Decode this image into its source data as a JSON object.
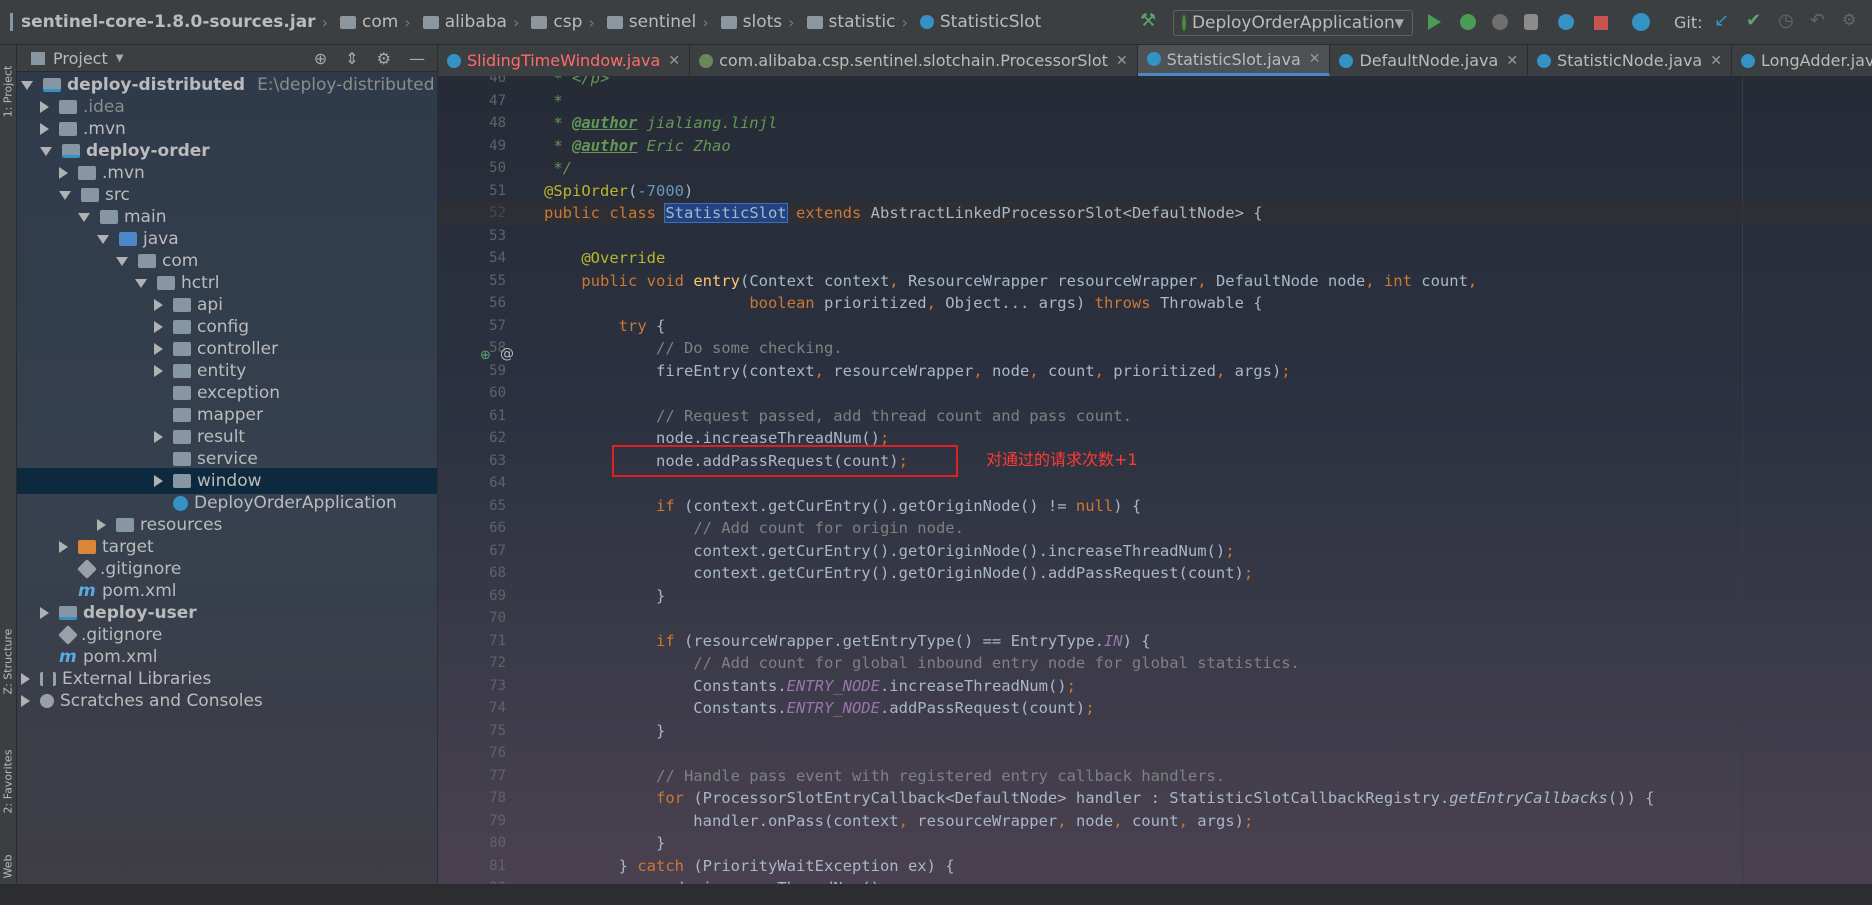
{
  "breadcrumb": [
    "sentinel-core-1.8.0-sources.jar",
    "com",
    "alibaba",
    "csp",
    "sentinel",
    "slots",
    "statistic",
    "StatisticSlot"
  ],
  "toolbar": {
    "run_config": "DeployOrderApplication",
    "git_label": "Git:"
  },
  "left_strip": {
    "project": "1: Project",
    "structure": "Z: Structure",
    "favorites": "2: Favorites",
    "web": "Web"
  },
  "project_panel": {
    "title": "Project",
    "tree": [
      {
        "label": "deploy-distributed",
        "path": "E:\\deploy-distributed",
        "arrow": "down",
        "icon": "mod",
        "bold": true,
        "indent": 0
      },
      {
        "label": ".idea",
        "arrow": "right",
        "icon": "folder",
        "indent": 1,
        "muted": true
      },
      {
        "label": ".mvn",
        "arrow": "right",
        "icon": "folder",
        "indent": 1
      },
      {
        "label": "deploy-order",
        "arrow": "down",
        "icon": "mod",
        "bold": true,
        "indent": 1
      },
      {
        "label": ".mvn",
        "arrow": "right",
        "icon": "folder",
        "indent": 2
      },
      {
        "label": "src",
        "arrow": "down",
        "icon": "folder",
        "indent": 2
      },
      {
        "label": "main",
        "arrow": "down",
        "icon": "folder",
        "indent": 3
      },
      {
        "label": "java",
        "arrow": "down",
        "icon": "src",
        "indent": 4
      },
      {
        "label": "com",
        "arrow": "down",
        "icon": "pkg",
        "indent": 5
      },
      {
        "label": "hctrl",
        "arrow": "down",
        "icon": "pkg",
        "indent": 6
      },
      {
        "label": "api",
        "arrow": "right",
        "icon": "pkg",
        "indent": 7
      },
      {
        "label": "config",
        "arrow": "right",
        "icon": "pkg",
        "indent": 7
      },
      {
        "label": "controller",
        "arrow": "right",
        "icon": "pkg",
        "indent": 7
      },
      {
        "label": "entity",
        "arrow": "right",
        "icon": "pkg",
        "indent": 7
      },
      {
        "label": "exception",
        "arrow": "none",
        "icon": "pkg",
        "indent": 7
      },
      {
        "label": "mapper",
        "arrow": "none",
        "icon": "pkg",
        "indent": 7
      },
      {
        "label": "result",
        "arrow": "right",
        "icon": "pkg",
        "indent": 7
      },
      {
        "label": "service",
        "arrow": "none",
        "icon": "pkg",
        "indent": 7
      },
      {
        "label": "window",
        "arrow": "right",
        "icon": "pkg",
        "indent": 7,
        "selected": true
      },
      {
        "label": "DeployOrderApplication",
        "arrow": "none",
        "icon": "cls",
        "indent": 7
      },
      {
        "label": "resources",
        "arrow": "right",
        "icon": "folder",
        "indent": 4
      },
      {
        "label": "target",
        "arrow": "right",
        "icon": "orange",
        "indent": 2
      },
      {
        "label": ".gitignore",
        "arrow": "none",
        "icon": "git",
        "indent": 2
      },
      {
        "label": "pom.xml",
        "arrow": "none",
        "icon": "maven",
        "indent": 2
      },
      {
        "label": "deploy-user",
        "arrow": "right",
        "icon": "mod",
        "bold": true,
        "indent": 1
      },
      {
        "label": ".gitignore",
        "arrow": "none",
        "icon": "git",
        "indent": 1
      },
      {
        "label": "pom.xml",
        "arrow": "none",
        "icon": "maven",
        "indent": 1
      },
      {
        "label": "External Libraries",
        "arrow": "right",
        "icon": "lib",
        "indent": 0
      },
      {
        "label": "Scratches and Consoles",
        "arrow": "right",
        "icon": "scr",
        "indent": 0
      }
    ]
  },
  "tabs": [
    {
      "label": "SlidingTimeWindow.java",
      "error": true,
      "active": false
    },
    {
      "label": "com.alibaba.csp.sentinel.slotchain.ProcessorSlot",
      "active": false,
      "noicon": true
    },
    {
      "label": "StatisticSlot.java",
      "active": true
    },
    {
      "label": "DefaultNode.java",
      "active": false
    },
    {
      "label": "StatisticNode.java",
      "active": false
    },
    {
      "label": "LongAdder.java",
      "active": false
    }
  ],
  "editor": {
    "first_line": 46,
    "current_line": 52,
    "annotation_text": "对通过的请求次数+1",
    "lines": [
      "<span class=\"doc\"> * &lt;/p&gt;</span>",
      "<span class=\"doc\"> *</span>",
      "<span class=\"doc\"> * </span><span class=\"doctag\">@author</span><span class=\"doc\"> jialiang.linjl</span>",
      "<span class=\"doc\"> * </span><span class=\"doctag\">@author</span><span class=\"doc\"> Eric Zhao</span>",
      "<span class=\"doc\"> */</span>",
      "<span class=\"an\">@SpiOrder</span>(<span class=\"num\">-7000</span>)",
      "<span class=\"kw\">public class </span><span class=\"selw\">StatisticSlot</span> <span class=\"kw\">extends </span>AbstractLinkedProcessorSlot&lt;DefaultNode&gt; {",
      "",
      "    <span class=\"an\">@Override</span>",
      "    <span class=\"kw\">public void </span><span class=\"fn\">entry</span>(Context context<span class=\"kw\">, </span>ResourceWrapper resourceWrapper<span class=\"kw\">, </span>DefaultNode node<span class=\"kw\">, int </span>count<span class=\"kw\">,</span>",
      "                      <span class=\"kw\">boolean </span>prioritized<span class=\"kw\">, </span>Object... args) <span class=\"kw\">throws </span>Throwable {",
      "        <span class=\"kw\">try </span>{",
      "            <span class=\"cm\">// Do some checking.</span>",
      "            fireEntry(context<span class=\"kw\">, </span>resourceWrapper<span class=\"kw\">, </span>node<span class=\"kw\">, </span>count<span class=\"kw\">, </span>prioritized<span class=\"kw\">, </span>args)<span class=\"kw\">;</span>",
      "",
      "            <span class=\"cm\">// Request passed, add thread count and pass count.</span>",
      "            node.increaseThreadNum()<span class=\"kw\">;</span>",
      "            node.addPassRequest(count)<span class=\"kw\">;</span>",
      "",
      "            <span class=\"kw\">if </span>(context.getCurEntry().getOriginNode() != <span class=\"kw\">null</span>) {",
      "                <span class=\"cm\">// Add count for origin node.</span>",
      "                context.getCurEntry().getOriginNode().increaseThreadNum()<span class=\"kw\">;</span>",
      "                context.getCurEntry().getOriginNode().addPassRequest(count)<span class=\"kw\">;</span>",
      "            }",
      "",
      "            <span class=\"kw\">if </span>(resourceWrapper.getEntryType() == EntryType.<span class=\"st\">IN</span>) {",
      "                <span class=\"cm\">// Add count for global inbound entry node for global statistics.</span>",
      "                Constants.<span class=\"st\">ENTRY_NODE</span>.increaseThreadNum()<span class=\"kw\">;</span>",
      "                Constants.<span class=\"st\">ENTRY_NODE</span>.addPassRequest(count)<span class=\"kw\">;</span>",
      "            }",
      "",
      "            <span class=\"cm\">// Handle pass event with registered entry callback handlers.</span>",
      "            <span class=\"kw\">for </span>(ProcessorSlotEntryCallback&lt;DefaultNode&gt; handler : StatisticSlotCallbackRegistry.<span class=\"it\">getEntryCallbacks</span>()) {",
      "                handler.onPass(context<span class=\"kw\">, </span>resourceWrapper<span class=\"kw\">, </span>node<span class=\"kw\">, </span>count<span class=\"kw\">, </span>args)<span class=\"kw\">;</span>",
      "            }",
      "        } <span class=\"kw\">catch </span>(PriorityWaitException ex) {",
      "            node.increaseThreadNum()<span class=\"kw\">;</span>"
    ]
  }
}
